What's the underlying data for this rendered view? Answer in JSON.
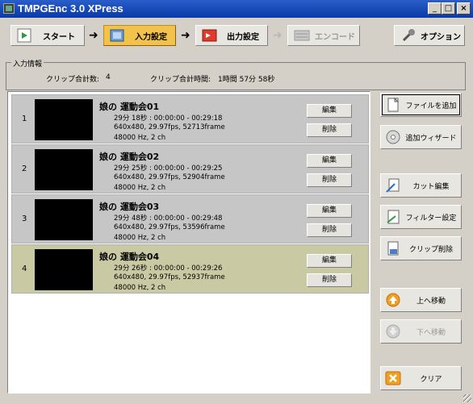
{
  "window": {
    "title": "TMPGEnc 3.0 XPress",
    "min": "_",
    "max": "□",
    "close": "×"
  },
  "toolbar": {
    "start": "スタート",
    "input": "入力設定",
    "output": "出力設定",
    "encode": "エンコード",
    "options": "オプション",
    "arrow": "➜"
  },
  "info": {
    "group_title": "入力情報",
    "clip_count_label": "クリップ合計数:",
    "clip_count": "4",
    "total_time_label": "クリップ合計時間:",
    "total_time": "1時間 57分 58秒"
  },
  "clips": [
    {
      "num": "1",
      "name": "娘の 運動会01",
      "line1": "29分 18秒 : 00:00:00 - 00:29:18",
      "line2": "640x480, 29.97fps, 52713frame",
      "line3": "48000 Hz, 2 ch",
      "edit": "編集",
      "delete": "削除"
    },
    {
      "num": "2",
      "name": "娘の 運動会02",
      "line1": "29分 25秒 : 00:00:00 - 00:29:25",
      "line2": "640x480, 29.97fps, 52904frame",
      "line3": "48000 Hz, 2 ch",
      "edit": "編集",
      "delete": "削除"
    },
    {
      "num": "3",
      "name": "娘の 運動会03",
      "line1": "29分 48秒 : 00:00:00 - 00:29:48",
      "line2": "640x480, 29.97fps, 53596frame",
      "line3": "48000 Hz, 2 ch",
      "edit": "編集",
      "delete": "削除"
    },
    {
      "num": "4",
      "name": "娘の 運動会04",
      "line1": "29分 26秒 : 00:00:00 - 00:29:26",
      "line2": "640x480, 29.97fps, 52937frame",
      "line3": "48000 Hz, 2 ch",
      "edit": "編集",
      "delete": "削除"
    }
  ],
  "side": {
    "add_file": "ファイルを追加",
    "add_wizard": "追加ウィザード",
    "cut_edit": "カット編集",
    "filter": "フィルター設定",
    "clip_delete": "クリップ削除",
    "move_up": "上へ移動",
    "move_down": "下へ移動",
    "clear": "クリア"
  },
  "colors": {
    "titlebar": "#0a3aa8",
    "selected_clip": "#c9caa3",
    "clip": "#c6c6c6",
    "input_active": "#f3c24a",
    "output_icon": "#e03a2a"
  }
}
